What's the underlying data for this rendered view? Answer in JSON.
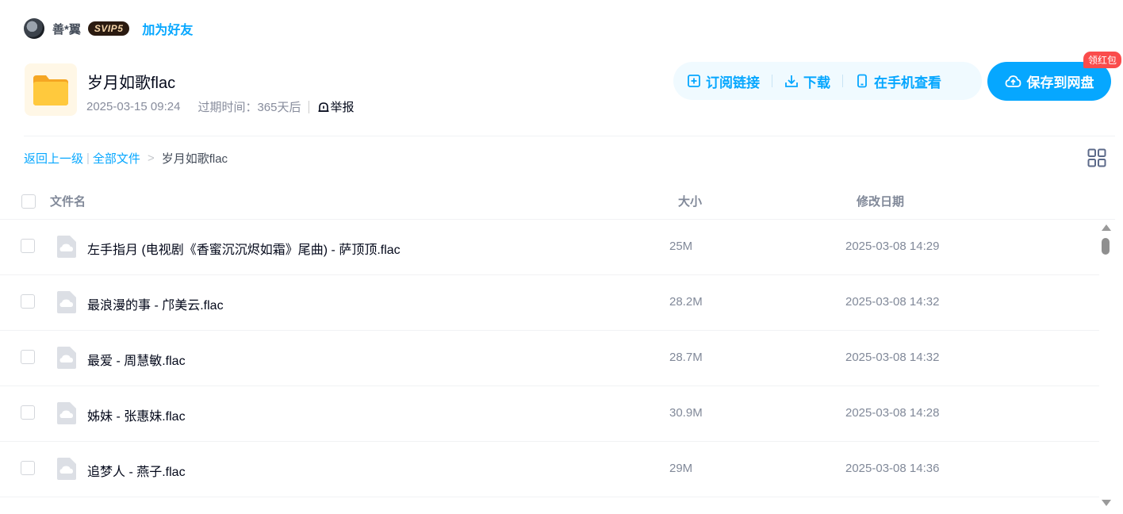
{
  "user": {
    "name": "善*翼",
    "vip_badge": "SVIP5",
    "add_friend_label": "加为好友"
  },
  "share": {
    "title": "岁月如歌flac",
    "created": "2025-03-15 09:24",
    "expire_label": "过期时间：365天后",
    "report_label": "举报"
  },
  "actions": {
    "subscribe_label": "订阅链接",
    "download_label": "下载",
    "phone_label": "在手机查看",
    "save_label": "保存到网盘",
    "red_packet_label": "领红包"
  },
  "breadcrumb": {
    "back_label": "返回上一级",
    "all_files_label": "全部文件",
    "current": "岁月如歌flac"
  },
  "table": {
    "columns": {
      "name": "文件名",
      "size": "大小",
      "modified": "修改日期"
    },
    "rows": [
      {
        "name": "左手指月 (电视剧《香蜜沉沉烬如霜》尾曲) - 萨顶顶.flac",
        "size": "25M",
        "modified": "2025-03-08 14:29"
      },
      {
        "name": "最浪漫的事 - 邝美云.flac",
        "size": "28.2M",
        "modified": "2025-03-08 14:32"
      },
      {
        "name": "最爱 - 周慧敏.flac",
        "size": "28.7M",
        "modified": "2025-03-08 14:32"
      },
      {
        "name": "姊妹 - 张惠妹.flac",
        "size": "30.9M",
        "modified": "2025-03-08 14:28"
      },
      {
        "name": "追梦人 - 燕子.flac",
        "size": "29M",
        "modified": "2025-03-08 14:36"
      }
    ]
  },
  "icons": {
    "folder": "folder-icon",
    "file": "cloud-file-icon",
    "view_toggle": "grid-view-icon"
  },
  "colors": {
    "accent": "#06a7ff",
    "action_bar_bg": "#f0faff",
    "red_packet": "#fa4c4c",
    "folder_yellow": "#ffc53d"
  }
}
